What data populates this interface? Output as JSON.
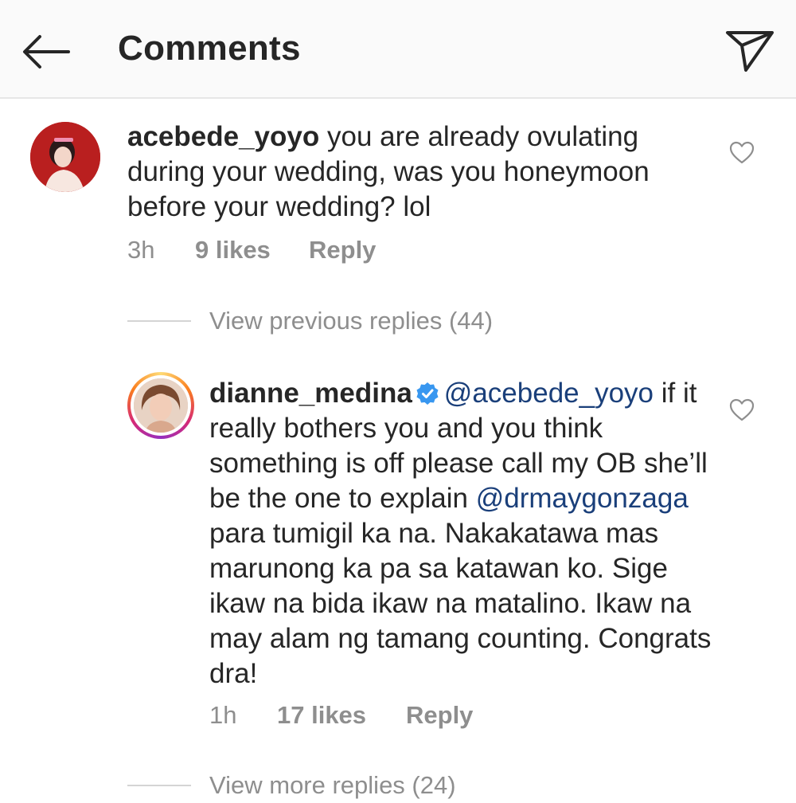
{
  "header": {
    "back_icon": "arrow-left-icon",
    "title": "Comments",
    "share_icon": "paper-plane-icon"
  },
  "comment1": {
    "username": "acebede_yoyo",
    "text": "you are already ovulating during your wedding, was you honeymoon before your wedding? lol",
    "time": "3h",
    "likes": "9 likes",
    "reply_label": "Reply",
    "avatar_color": "#b91f1f"
  },
  "view_previous": "View previous replies (44)",
  "comment2": {
    "username": "dianne_medina",
    "verified_icon": "verified-badge-icon",
    "mention1": "@acebede_yoyo",
    "text_a": "if it really bothers you and you think something is off please call my OB she’ll be the one to explain",
    "mention2": "@drmaygonzaga",
    "text_b": "para tumigil ka na. Nakakatawa mas marunong ka pa sa katawan ko. Sige ikaw na bida ikaw na matalino. Ikaw na may alam ng tamang counting. Congrats dra!",
    "time": "1h",
    "likes": "17 likes",
    "reply_label": "Reply"
  },
  "view_more": "View more replies (24)",
  "colors": {
    "verified": "#3897f0",
    "mention": "#1a3f7a",
    "meta_text": "#8e8e8e"
  }
}
